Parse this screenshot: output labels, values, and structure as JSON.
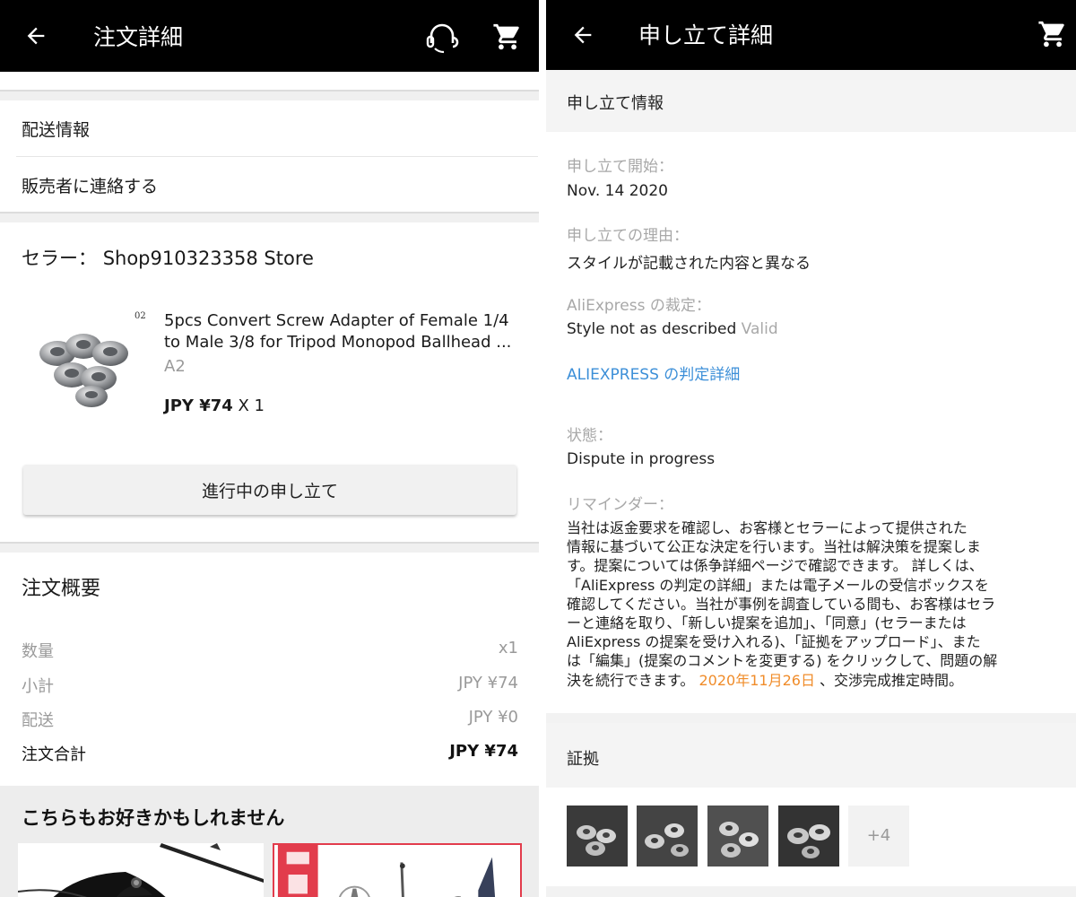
{
  "left": {
    "header": {
      "title": "注文詳細",
      "back_icon": "arrow-left-icon",
      "support_icon": "headset-icon",
      "cart_icon": "cart-icon"
    },
    "links": {
      "shipping": "配送情報",
      "contact": "販売者に連絡する"
    },
    "seller": {
      "label": "セラー：",
      "name": "Shop910323358 Store"
    },
    "product": {
      "badge": "02",
      "title": "5pcs Convert Screw Adapter of Female 1/4 to Male 3/8 for Tripod Monopod Ballhead ...",
      "variant": "A2",
      "price": "JPY ¥74",
      "quantity": "X 1"
    },
    "dispute_button": "進行中の申し立て",
    "summary": {
      "title": "注文概要",
      "rows": [
        {
          "label": "数量",
          "value": "x1"
        },
        {
          "label": "小計",
          "value": "JPY ¥74"
        },
        {
          "label": "配送",
          "value": "JPY ¥0"
        }
      ],
      "total": {
        "label": "注文合計",
        "value": "JPY ¥74"
      }
    },
    "recommend": {
      "title": "こちらもお好きかもしれません"
    }
  },
  "right": {
    "header": {
      "title": "申し立て詳細",
      "back_icon": "arrow-left-icon",
      "cart_icon": "cart-icon"
    },
    "info_title": "申し立て情報",
    "start": {
      "label": "申し立て開始：",
      "value": "Nov. 14 2020"
    },
    "reason": {
      "label": "申し立ての理由：",
      "value": "スタイルが記載された内容と異なる"
    },
    "verdict": {
      "label": "AliExpress の裁定：",
      "value": "Style not as described",
      "status": "Valid"
    },
    "verdict_link": "ALIEXPRESS の判定詳細",
    "state": {
      "label": "状態：",
      "value": "Dispute in progress"
    },
    "reminder": {
      "label": "リマインダー：",
      "lines": [
        "当社は返金要求を確認し、お客様とセラーによって提供された",
        "情報に基づいて公正な決定を行います。当社は解決策を提案しま",
        "す。提案については係争詳細ページで確認できます。 詳しくは、",
        "「AliExpress の判定の詳細」または電子メールの受信ボックスを",
        "確認してください。当社が事例を調査している間も、お客様はセラ",
        "ーと連絡を取り、「新しい提案を追加」、「同意」(セラーまたは",
        "AliExpress の提案を受け入れる)、「証拠をアップロード」、また",
        "は「編集」(提案のコメントを変更する) をクリックして、問題の解"
      ],
      "last_line_start": "決を続行できます。",
      "date": "2020年11月26日",
      "last_line_end": "、交渉完成推定時間。"
    },
    "evidence": {
      "title": "証拠",
      "more": "+4"
    },
    "colors": {
      "link": "#3c8fd8",
      "date": "#f08c2a",
      "header_bg": "#000000"
    }
  }
}
